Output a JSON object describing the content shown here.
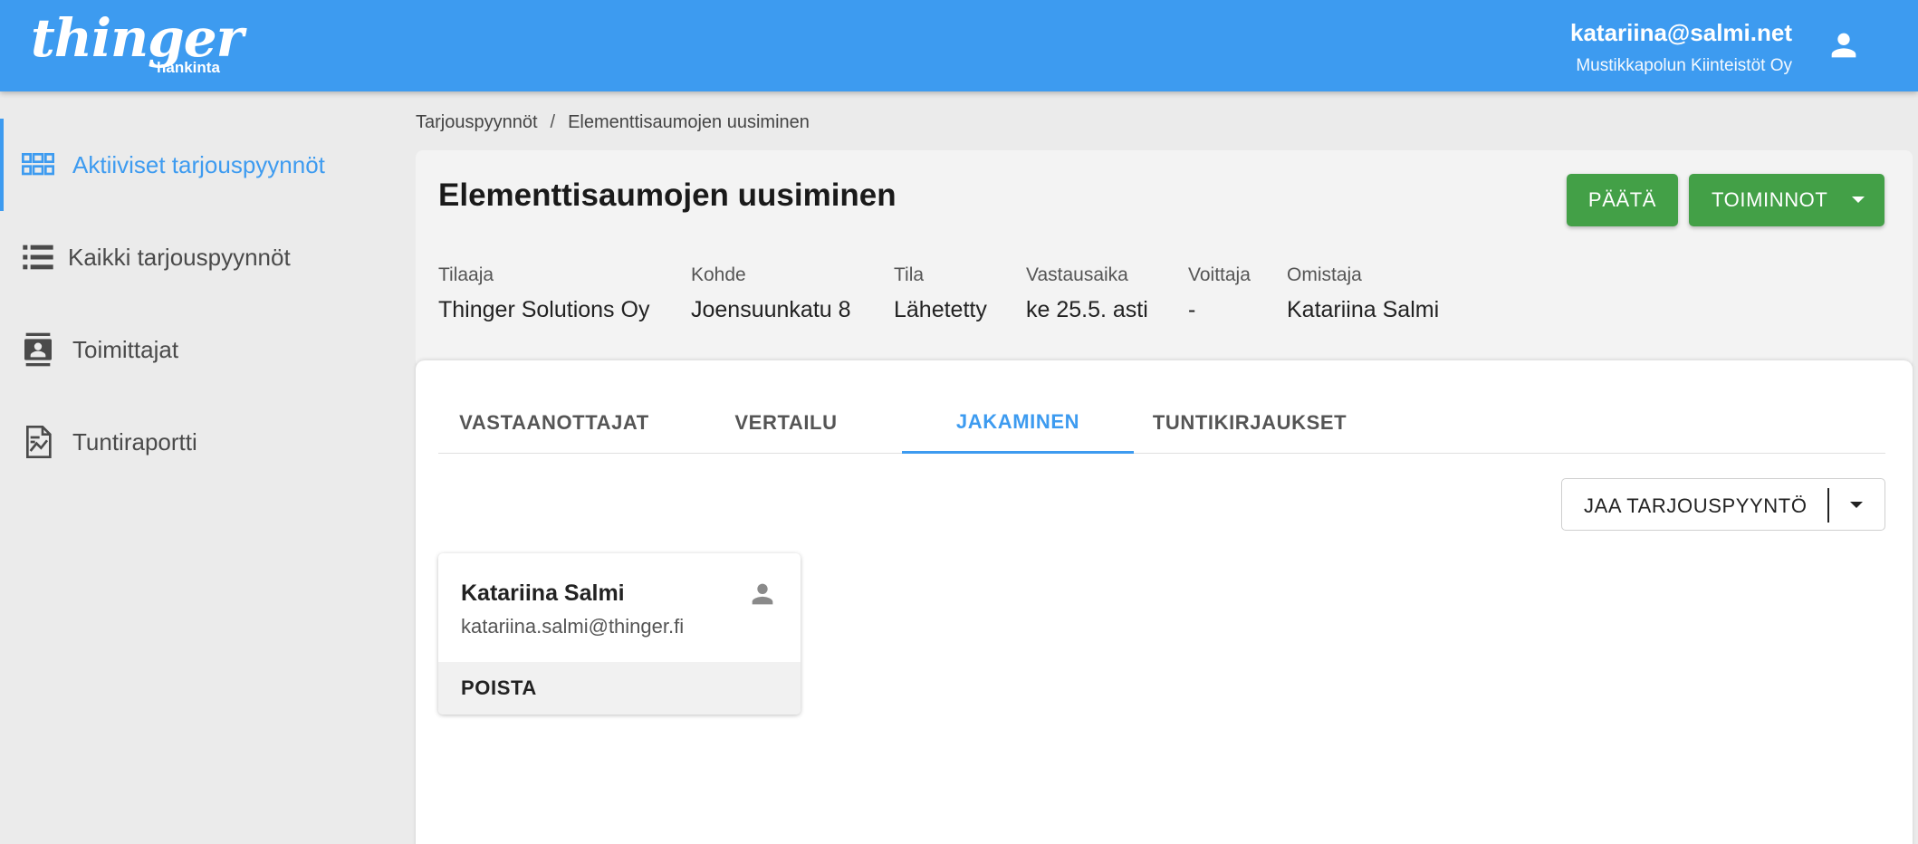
{
  "header": {
    "logo_text": "thinger",
    "logo_subtext": "hankinta",
    "user_email": "katariina@salmi.net",
    "user_org": "Mustikkapolun Kiinteistöt Oy",
    "user_icon": "account-icon"
  },
  "sidebar": {
    "items": [
      {
        "label": "Aktiiviset tarjouspyynnöt",
        "icon": "grid-icon",
        "active": true
      },
      {
        "label": "Kaikki tarjouspyynnöt",
        "icon": "list-icon",
        "active": false
      },
      {
        "label": "Toimittajat",
        "icon": "contacts-icon",
        "active": false
      },
      {
        "label": "Tuntiraportti",
        "icon": "report-chart-icon",
        "active": false
      }
    ]
  },
  "breadcrumb": {
    "root": "Tarjouspyynnöt",
    "separator": "/",
    "current": "Elementtisaumojen uusiminen"
  },
  "request": {
    "title": "Elementtisaumojen uusiminen",
    "decide_label": "PÄÄTÄ",
    "actions_label": "TOIMINNOT",
    "meta": [
      {
        "label": "Tilaaja",
        "value": "Thinger Solutions Oy"
      },
      {
        "label": "Kohde",
        "value": "Joensuunkatu 8"
      },
      {
        "label": "Tila",
        "value": "Lähetetty"
      },
      {
        "label": "Vastausaika",
        "value": "ke 25.5. asti"
      },
      {
        "label": "Voittaja",
        "value": "-"
      },
      {
        "label": "Omistaja",
        "value": "Katariina Salmi"
      }
    ]
  },
  "tabs": [
    {
      "label": "VASTAANOTTAJAT",
      "active": false
    },
    {
      "label": "VERTAILU",
      "active": false
    },
    {
      "label": "JAKAMINEN",
      "active": true
    },
    {
      "label": "TUNTIKIRJAUKSET",
      "active": false
    }
  ],
  "sharing": {
    "share_button_label": "JAA TARJOUSPYYNTÖ",
    "users": [
      {
        "name": "Katariina Salmi",
        "email": "katariina.salmi@thinger.fi",
        "remove_label": "POISTA",
        "icon": "person-icon"
      }
    ]
  },
  "colors": {
    "primary": "#3d9bf0",
    "success": "#43a047",
    "background": "#ebebeb"
  }
}
